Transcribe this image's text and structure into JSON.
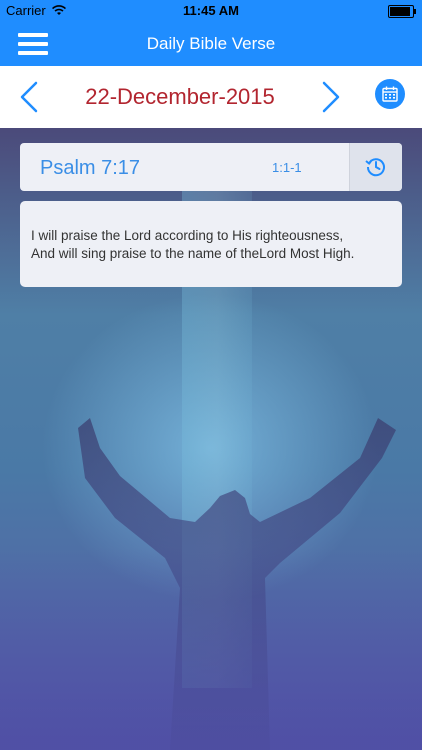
{
  "status_bar": {
    "carrier": "Carrier",
    "time": "11:45 AM"
  },
  "header": {
    "title": "Daily Bible Verse"
  },
  "date_nav": {
    "date": "22-December-2015"
  },
  "reference": {
    "book_ref": "Psalm 7:17",
    "number": "1:1-1"
  },
  "verse": {
    "line1": "I will praise the Lord according to His righteousness,",
    "line2": "And will sing praise to the name of theLord Most High."
  },
  "colors": {
    "accent": "#1f8dff",
    "date": "#b2252f",
    "ref": "#3a8ee6"
  },
  "icons": [
    "menu-icon",
    "chevron-left-icon",
    "chevron-right-icon",
    "calendar-icon",
    "history-icon",
    "wifi-icon",
    "battery-icon"
  ]
}
